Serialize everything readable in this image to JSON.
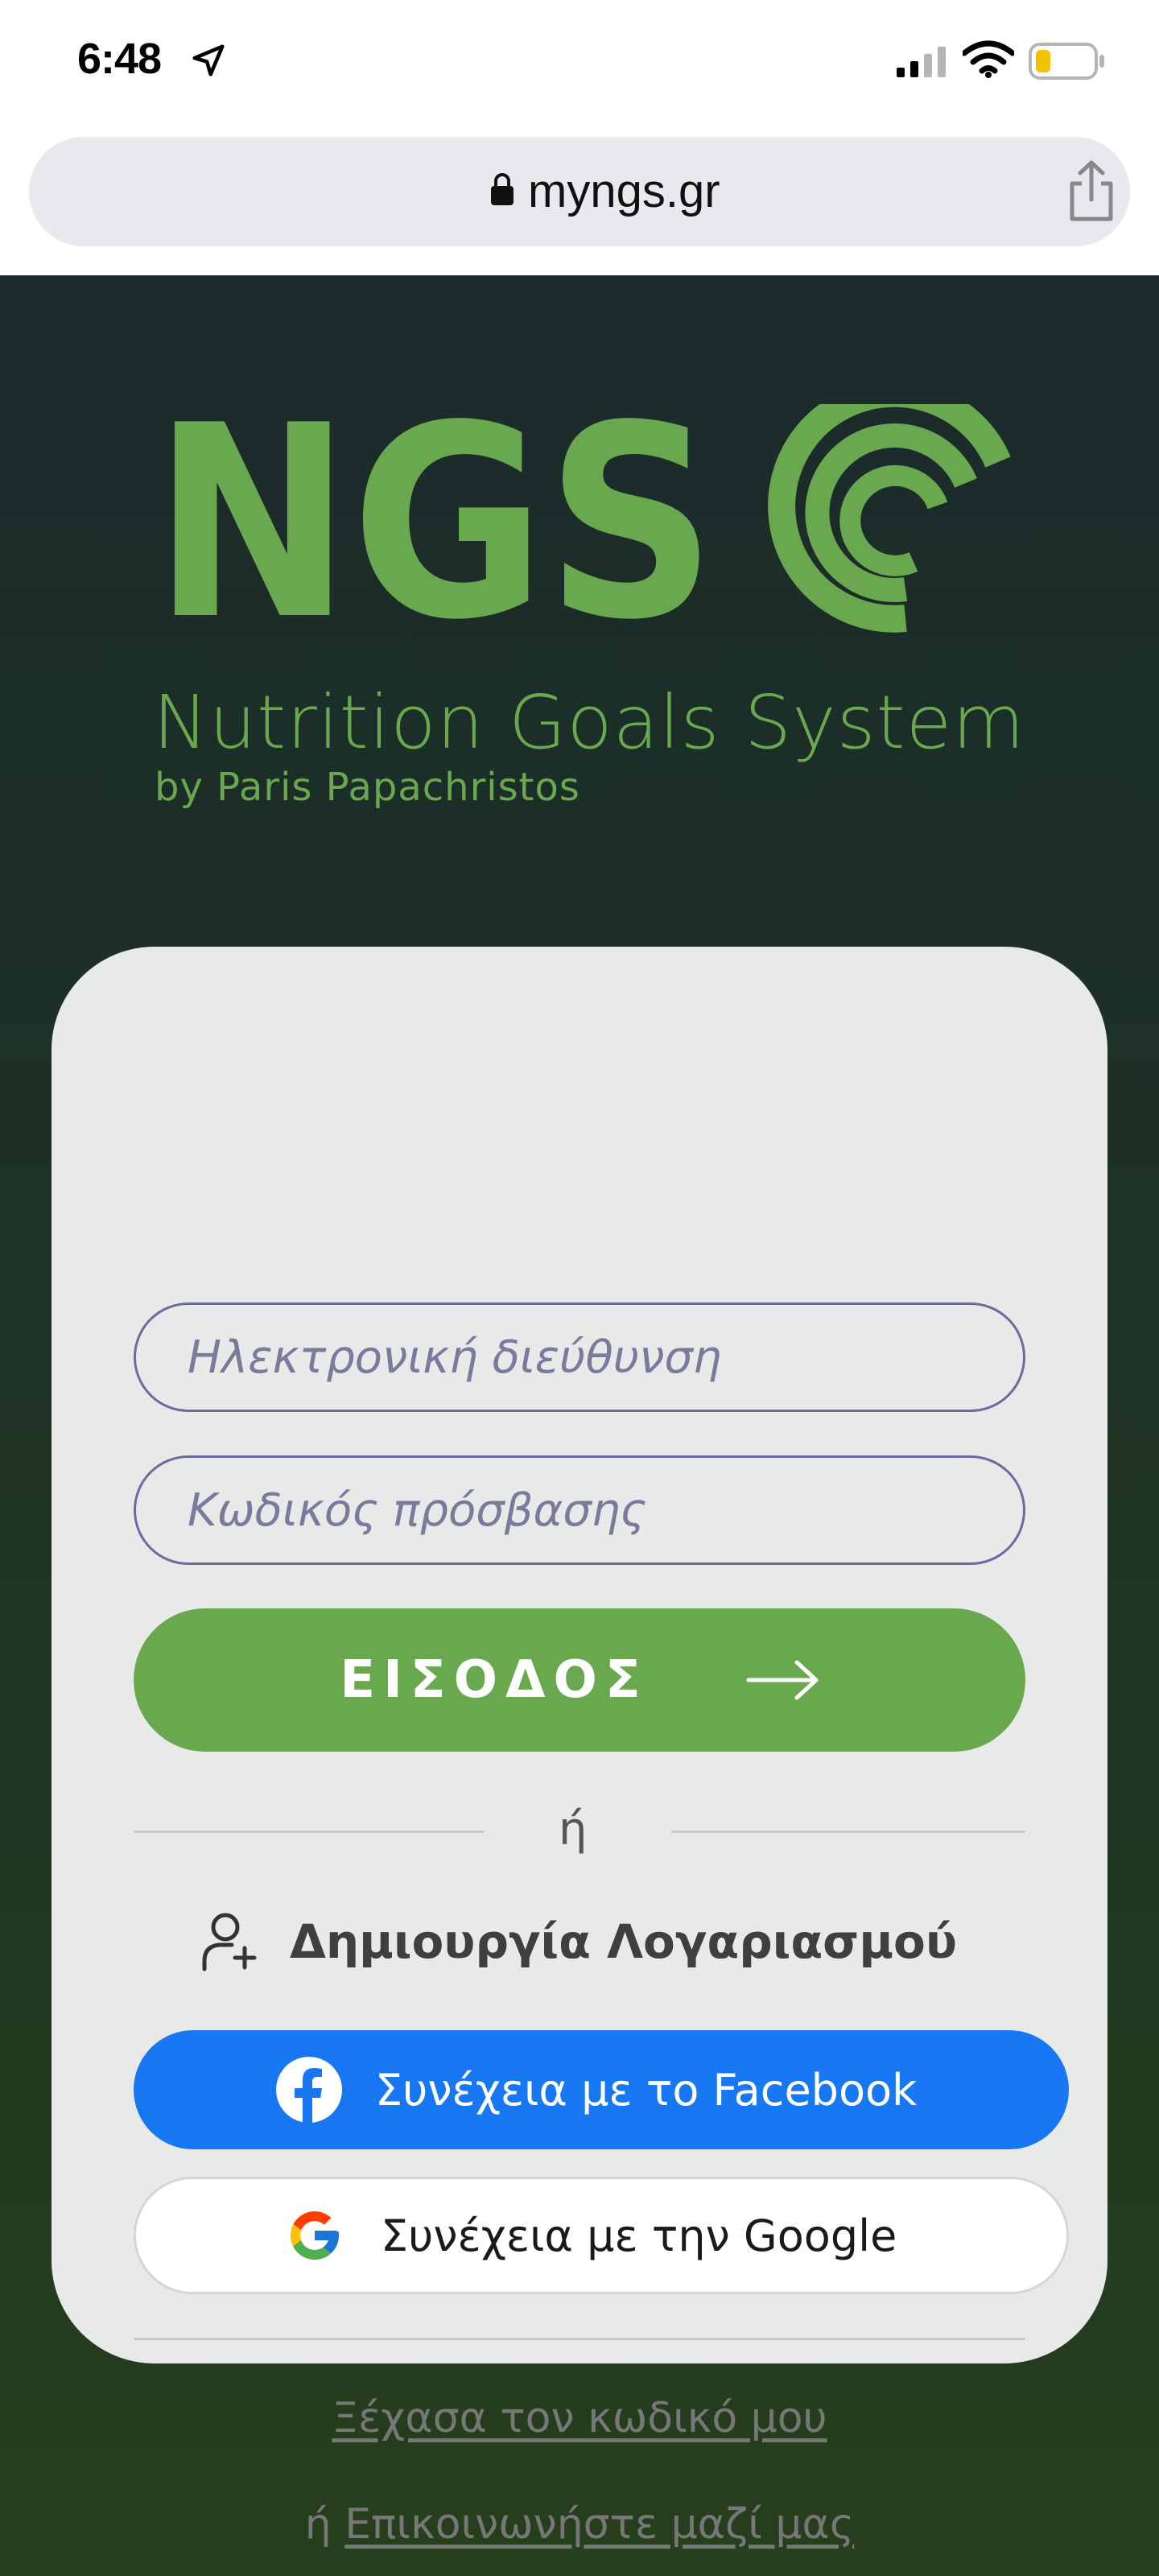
{
  "status_bar": {
    "time": "6:48"
  },
  "browser": {
    "url": "myngs.gr"
  },
  "brand": {
    "logo_text": "NGS",
    "name": "Nutrition Goals System",
    "byline": "by Paris Papachristos",
    "color": "#6aa84f"
  },
  "login_form": {
    "email_placeholder": "Ηλεκτρονική διεύθυνση",
    "password_placeholder": "Κωδικός πρόσβασης",
    "submit_label": "ΕΙΣΟΔΟΣ",
    "or_label": "ή",
    "create_account_label": "Δημιουργία Λογαριασμού",
    "facebook_label": "Συνέχεια με το Facebook",
    "google_label": "Συνέχεια με την Google",
    "forgot_password_label": "Ξέχασα τον κωδικό μου",
    "contact_prefix": "ή",
    "contact_label": "Επικοινωνήστε μαζί μας"
  },
  "icons": {
    "location": "location-arrow-icon",
    "signal": "cellular-signal-icon",
    "wifi": "wifi-icon",
    "battery": "battery-low-icon",
    "lock": "lock-icon",
    "share": "share-icon",
    "arrow": "arrow-right-icon",
    "user_add": "user-add-icon",
    "facebook": "facebook-icon",
    "google": "google-icon"
  },
  "colors": {
    "accent_green": "#6aa84f",
    "facebook_blue": "#1877f2",
    "card_bg": "#e8e9e9"
  }
}
